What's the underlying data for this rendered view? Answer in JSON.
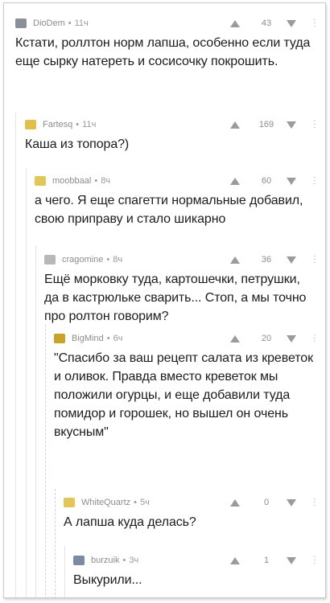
{
  "comments": [
    {
      "author": "DioDem",
      "time": "11ч",
      "score": "43",
      "avatar_color": "#8a8f99",
      "text": "Кстати, роллтон норм лапша, особенно если туда еще сырку натереть и сосисочку покрошить."
    },
    {
      "author": "Fartesq",
      "time": "11ч",
      "score": "169",
      "avatar_color": "#e0c04a",
      "text": "Каша из топора?)"
    },
    {
      "author": "moobbaal",
      "time": "8ч",
      "score": "60",
      "avatar_color": "#e3c658",
      "text": "а чего. Я еще спагетти нормальные добавил, свою приправу и стало шикарно"
    },
    {
      "author": "cragomine",
      "time": "8ч",
      "score": "36",
      "avatar_color": "#b8b8b8",
      "text": "Ещё морковку туда, картошечки, петрушки, да в кастрюльке сварить... Стоп, а мы точно про ролтон говорим?"
    },
    {
      "author": "BigMind",
      "time": "6ч",
      "score": "20",
      "avatar_color": "#c9a227",
      "text": "\"Спасибо за ваш рецепт салата из креветок и оливок. Правда вместо креветок мы положили огурцы, и еще добавили туда помидор и горошек, но вышел он очень вкусным\""
    },
    {
      "author": "WhiteQuartz",
      "time": "5ч",
      "score": "0",
      "avatar_color": "#e3c658",
      "text": "А лапша куда делась?"
    },
    {
      "author": "burzuik",
      "time": "3ч",
      "score": "1",
      "avatar_color": "#7d8aa3",
      "text": "Выкурили..."
    }
  ],
  "separator": "•"
}
